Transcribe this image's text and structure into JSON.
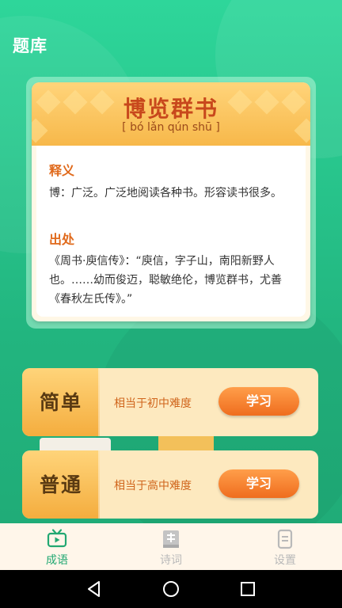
{
  "header": {
    "title": "题库"
  },
  "idiom_card": {
    "word": "博览群书",
    "pinyin": "[ bó lǎn qún shū ]",
    "meaning_title": "释义",
    "meaning_text": "博：广泛。广泛地阅读各种书。形容读书很多。",
    "source_title": "出处",
    "source_text": "《周书·庾信传》：“庾信，字子山，南阳新野人也。……幼而俊迈，聪敏绝伦，博览群书，尤善《春秋左氏传》。”"
  },
  "levels": [
    {
      "name": "简单",
      "description": "相当于初中难度",
      "button_label": "学习"
    },
    {
      "name": "普通",
      "description": "相当于高中难度",
      "button_label": "学习"
    }
  ],
  "tabs": [
    {
      "label": "成语",
      "icon": "tv-icon",
      "active": true
    },
    {
      "label": "诗词",
      "icon": "book-icon",
      "active": false
    },
    {
      "label": "设置",
      "icon": "settings-doc-icon",
      "active": false
    }
  ],
  "colors": {
    "primary_green": "#22a872",
    "accent_orange": "#ef6d1e",
    "title_red": "#c8481c",
    "card_gold": "#f7b84a"
  }
}
